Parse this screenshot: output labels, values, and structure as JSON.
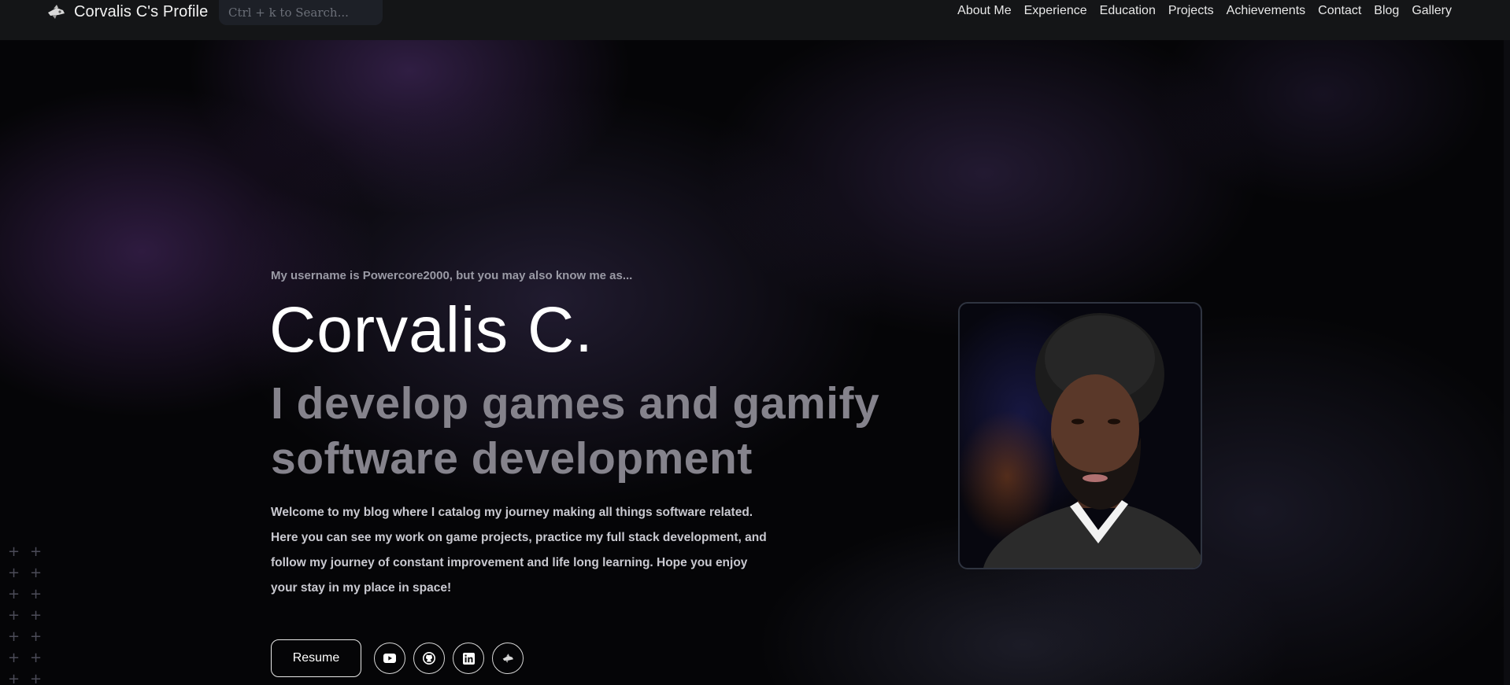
{
  "navbar": {
    "brand_title": "Corvalis C's Profile",
    "search_placeholder": "Ctrl + k to Search...",
    "links": [
      "About Me",
      "Experience",
      "Education",
      "Projects",
      "Achievements",
      "Contact",
      "Blog",
      "Gallery"
    ]
  },
  "hero": {
    "kicker": "My username is Powercore2000, but you may also know me as...",
    "name": "Corvalis C.",
    "tagline": "I develop games and gamify software development",
    "description": "Welcome to my blog where I catalog my journey making all things software related. Here you can see my work on game projects, practice my full stack development, and follow my journey of constant improvement and life long learning. Hope you enjoy your stay in my place in space!",
    "resume_label": "Resume",
    "socials": [
      "youtube-icon",
      "github-icon",
      "linkedin-icon",
      "spaceship-icon"
    ]
  },
  "colors": {
    "nav_bg": "#141517",
    "tagline": "#85838c",
    "kicker": "#9a9aa5"
  }
}
